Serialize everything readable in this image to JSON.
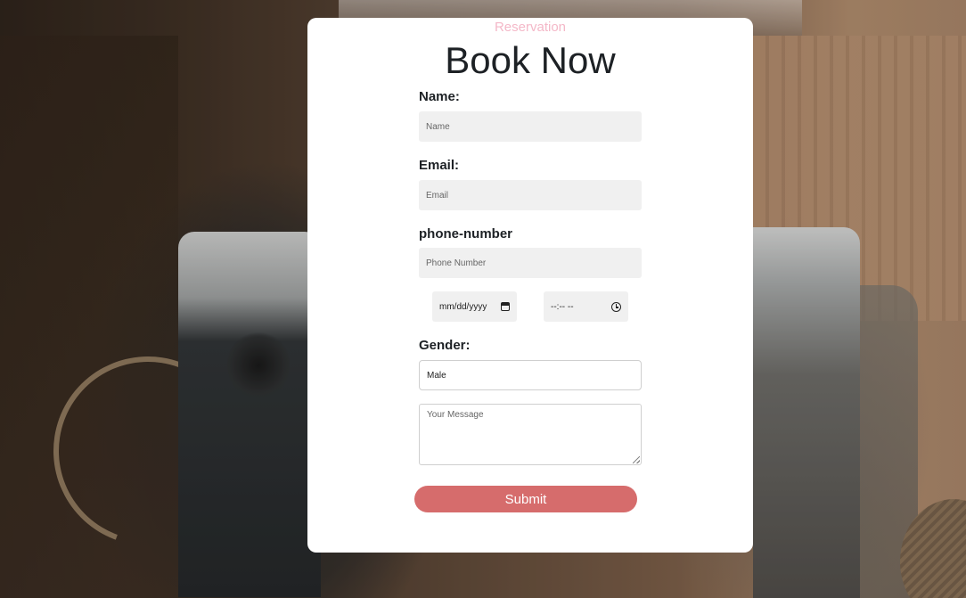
{
  "form": {
    "eyebrow": "Reservation",
    "title": "Book Now",
    "name_label": "Name:",
    "name_placeholder": "Name",
    "email_label": "Email:",
    "email_placeholder": "Email",
    "phone_label": "phone-number",
    "phone_placeholder": "Phone Number",
    "date_placeholder": "mm/dd/yyyy",
    "time_placeholder": "--:-- --",
    "gender_label": "Gender:",
    "gender_selected": "Male",
    "message_placeholder": "Your Message",
    "submit_label": "Submit"
  },
  "colors": {
    "eyebrow": "#f4b8c8",
    "submit": "#d66c6c",
    "input_bg": "#f0f0f0",
    "card_bg": "#ffffff"
  },
  "icons": {
    "date": "calendar-icon",
    "time": "clock-icon"
  }
}
